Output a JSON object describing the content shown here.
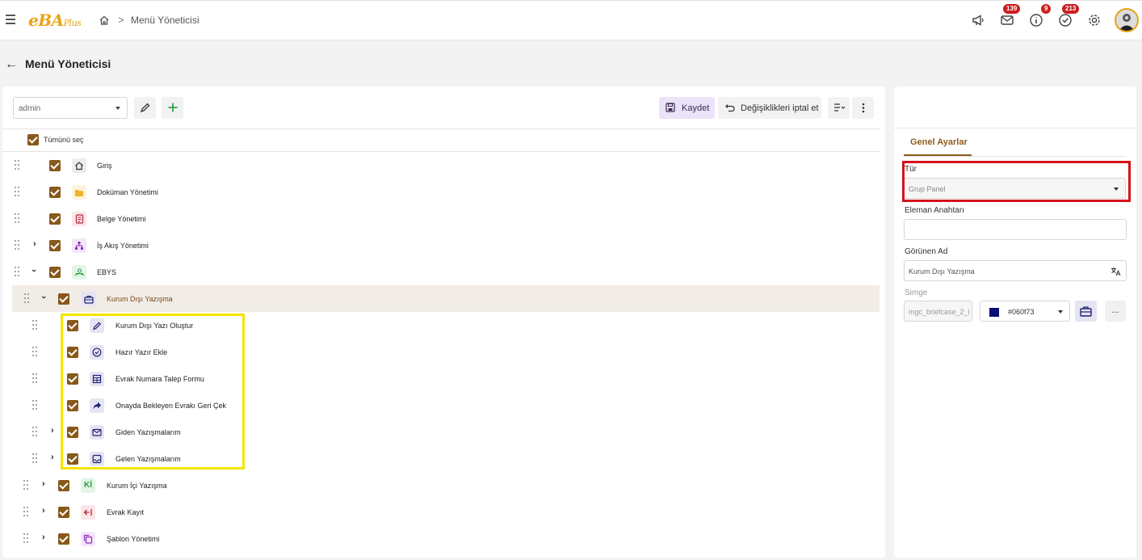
{
  "header": {
    "logo_main": "eBA",
    "logo_sub": "Plus",
    "breadcrumb_sep": ">",
    "breadcrumb": "Menü Yöneticisi",
    "badges": {
      "mail": "139",
      "info": "9",
      "tasks": "213"
    }
  },
  "page": {
    "title": "Menü Yöneticisi"
  },
  "toolbar": {
    "user_select": "admin",
    "save_label": "Kaydet",
    "cancel_label": "Değişiklikleri iptal et"
  },
  "tree": {
    "select_all": "Tümünü seç",
    "items": [
      {
        "label": "Giriş",
        "icon": "home-icon"
      },
      {
        "label": "Doküman Yönetimi",
        "icon": "folder-icon"
      },
      {
        "label": "Belge Yönetimi",
        "icon": "document-icon"
      },
      {
        "label": "İş Akış Yönetimi",
        "icon": "workflow-icon"
      },
      {
        "label": "EBYS",
        "icon": "ebys-icon"
      },
      {
        "label": "Kurum Dışı Yazışma",
        "icon": "briefcase-icon"
      },
      {
        "label": "Kurum Dışı Yazı Oluştur",
        "icon": "pencil-icon"
      },
      {
        "label": "Hazır Yazır Ekle",
        "icon": "check-circle-icon"
      },
      {
        "label": "Evrak Numara Talep Formu",
        "icon": "form-icon"
      },
      {
        "label": "Onayda Bekleyen Evrakı Geri Çek",
        "icon": "share-arrow-icon"
      },
      {
        "label": "Giden Yazışmalarım",
        "icon": "outbox-icon"
      },
      {
        "label": "Gelen Yazışmalarım",
        "icon": "inbox-icon"
      },
      {
        "label": "Kurum İçi Yazışma",
        "icon": "ki-icon",
        "icon_text": "Kİ"
      },
      {
        "label": "Evrak Kayıt",
        "icon": "sign-in-icon"
      },
      {
        "label": "Şablon Yönetimi",
        "icon": "copy-icon"
      }
    ]
  },
  "settings": {
    "tab": "Genel Ayarlar",
    "type_label": "Tür",
    "type_value": "Grup Panel",
    "key_label": "Eleman Anahtarı",
    "key_value": "",
    "display_label": "Görünen Ad",
    "display_value": "Kurum Dışı Yazışma",
    "icon_label": "Simge",
    "icon_value": "mgc_briefcase_2_l",
    "color_value": "#060f73",
    "more": "..."
  },
  "colors": {
    "accent": "#87591a",
    "selected_row": "#f1ece6",
    "badge": "#cc1e1e",
    "highlight_red": "#d4121c",
    "highlight_yellow": "#f5e400"
  }
}
